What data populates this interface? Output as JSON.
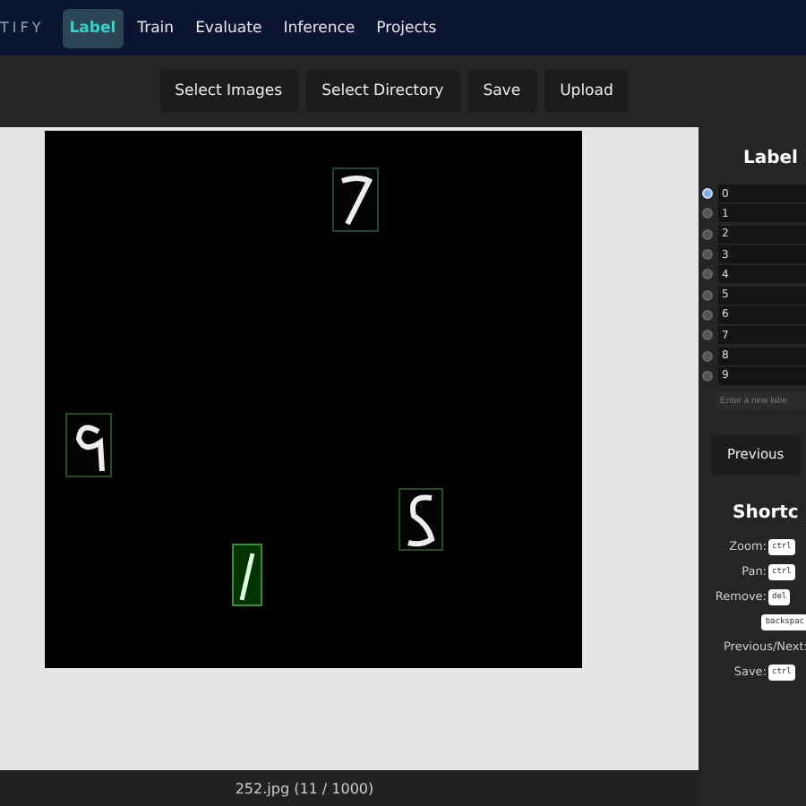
{
  "nav": {
    "logo": "TIFY",
    "tabs": [
      {
        "label": "Label",
        "selected": true
      },
      {
        "label": "Train",
        "selected": false
      },
      {
        "label": "Evaluate",
        "selected": false
      },
      {
        "label": "Inference",
        "selected": false
      },
      {
        "label": "Projects",
        "selected": false
      }
    ]
  },
  "toolbar": [
    "Select Images",
    "Select Directory",
    "Save",
    "Upload"
  ],
  "canvas": {
    "kind": "picture"
  },
  "status": "252.jpg (11 / 1000)",
  "labels_panel": {
    "title": "Label",
    "labels": [
      {
        "name": "0",
        "selected": true
      },
      {
        "name": "1",
        "selected": false
      },
      {
        "name": "2",
        "selected": false
      },
      {
        "name": "3",
        "selected": false
      },
      {
        "name": "4",
        "selected": false
      },
      {
        "name": "5",
        "selected": false
      },
      {
        "name": "6",
        "selected": false
      },
      {
        "name": "7",
        "selected": false
      },
      {
        "name": "8",
        "selected": false
      },
      {
        "name": "9",
        "selected": false
      }
    ],
    "new_label": {
      "placeholder": "Enter a new labe"
    }
  },
  "nav_buttons": [
    "Previous"
  ],
  "shortcuts": {
    "title": "Shortc",
    "rows": [
      {
        "label": "Zoom:",
        "keys": [
          "ctrl"
        ]
      },
      {
        "label": "Pan:",
        "keys": [
          "ctrl"
        ]
      },
      {
        "label": "Remove:",
        "keys": [
          "del"
        ]
      },
      {
        "label": "",
        "keys": [
          "backspac"
        ]
      },
      {
        "label": "Previous/Next:",
        "keys": []
      },
      {
        "label": "Save:",
        "keys": [
          "ctrl"
        ]
      }
    ]
  }
}
